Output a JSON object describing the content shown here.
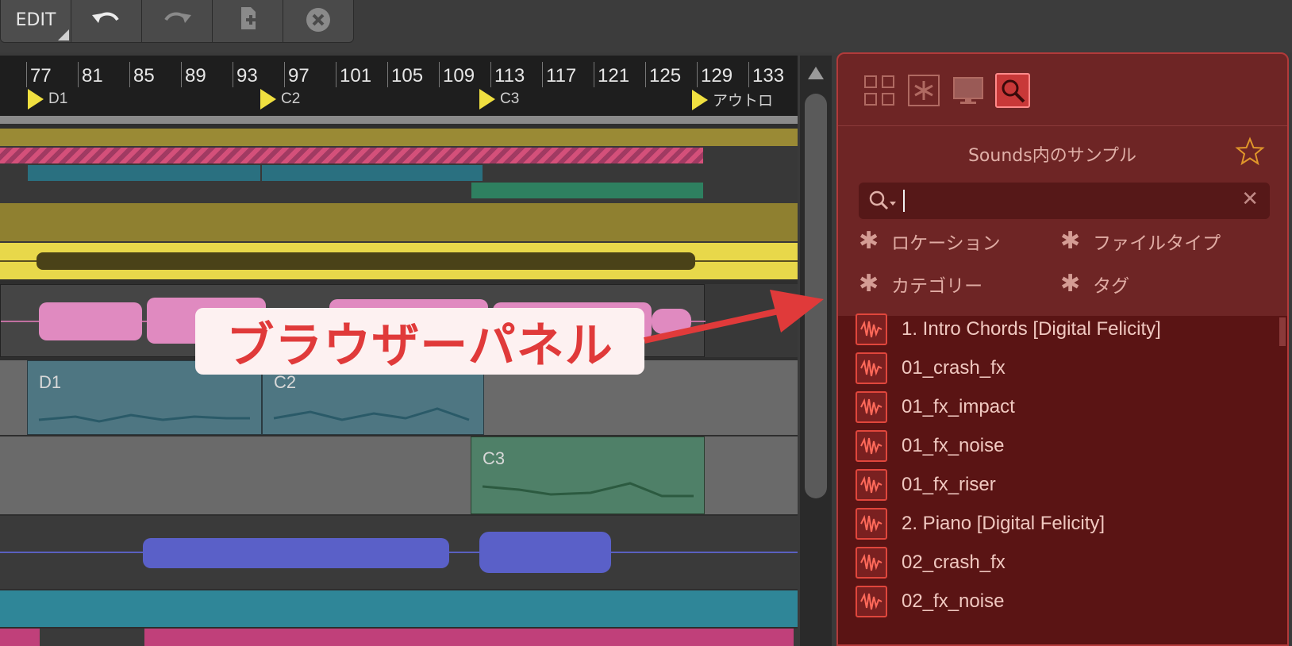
{
  "toolbar": {
    "edit_label": "EDIT",
    "buttons": [
      "undo-icon",
      "redo-icon",
      "duplicate-icon",
      "close-icon"
    ]
  },
  "ruler": {
    "bars": [
      "77",
      "81",
      "85",
      "89",
      "93",
      "97",
      "101",
      "105",
      "109",
      "113",
      "117",
      "121",
      "125",
      "129",
      "133"
    ],
    "cues": [
      "D1",
      "C2",
      "C3",
      "アウトロ"
    ]
  },
  "clips": {
    "d1": "D1",
    "c2": "C2",
    "c3": "C3"
  },
  "callout": {
    "text": "ブラウザーパネル"
  },
  "browser": {
    "tabs": [
      "grid-icon",
      "asterisk-icon",
      "monitor-icon",
      "search-icon"
    ],
    "active_tab": "search-icon",
    "title": "Sounds内のサンプル",
    "search": {
      "value": "",
      "placeholder": ""
    },
    "filters": [
      "ロケーション",
      "ファイルタイプ",
      "カテゴリー",
      "タグ"
    ],
    "items": [
      "1. Intro Chords [Digital Felicity]",
      "01_crash_fx",
      "01_fx_impact",
      "01_fx_noise",
      "01_fx_riser",
      "2. Piano [Digital Felicity]",
      "02_crash_fx",
      "02_fx_noise"
    ]
  },
  "colors": {
    "browser_bg": "#6e2525",
    "accent_red": "#e03a3a",
    "cue_flag": "#f0e040"
  }
}
